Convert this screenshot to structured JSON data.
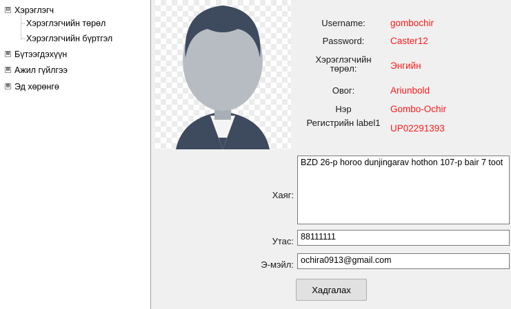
{
  "tree": {
    "nodes": [
      {
        "label": "Хэрэглэгч",
        "expander": "⊟"
      },
      {
        "label": "Хэрэглэгчийн төрөл"
      },
      {
        "label": "Хэрэглэгчийн бүртгэл"
      },
      {
        "label": "Бүтээгдэхүүн",
        "expander": "⊞"
      },
      {
        "label": "Ажил гүйлгээ",
        "expander": "⊞"
      },
      {
        "label": "Эд хөрөнгө",
        "expander": "⊞"
      }
    ]
  },
  "profile": {
    "photo_icon": "user-silhouette-icon",
    "fields": [
      {
        "label": "Username:",
        "value": "gombochir"
      },
      {
        "label": "Password:",
        "value": "Caster12"
      },
      {
        "label": "Хэрэглэгчийн төрөл:",
        "value": "Энгийн"
      },
      {
        "label": "Овог:",
        "value": "Ariunbold"
      },
      {
        "label": "Нэр",
        "value": "Gombo-Ochir"
      },
      {
        "label": "Регистрийн label1",
        "value": "UP02291393"
      }
    ]
  },
  "form": {
    "address_label": "Хаяг:",
    "address_value": "BZD 26-р horoo dunjingarav hothon 107-р bair 7 toot",
    "phone_label": "Утас:",
    "phone_value": "88111111",
    "email_label": "Э-мэйл:",
    "email_value": "ochira0913@gmail.com",
    "save_label": "Хадгалах"
  },
  "colors": {
    "value_text": "#ff1a1a",
    "silhouette_dark": "#3e4a5e",
    "silhouette_head": "#b7bcc2"
  }
}
